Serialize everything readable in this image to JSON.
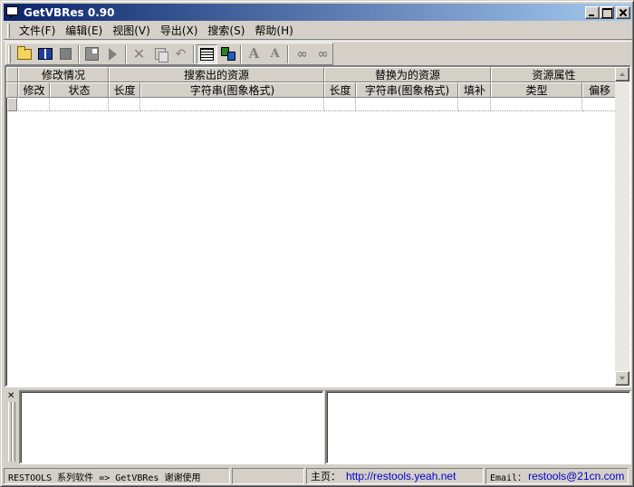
{
  "window": {
    "title": "GetVBRes 0.90"
  },
  "menu": {
    "items": [
      {
        "label": "文件(F)"
      },
      {
        "label": "编辑(E)"
      },
      {
        "label": "视图(V)"
      },
      {
        "label": "导出(X)"
      },
      {
        "label": "搜索(S)"
      },
      {
        "label": "帮助(H)"
      }
    ]
  },
  "toolbar": {
    "icons": [
      "open-folder-icon",
      "open-book-icon",
      "stop-icon",
      "export-icon",
      "play-icon",
      "cut-icon",
      "copy-icon",
      "undo-icon",
      "grid-view-icon",
      "network-icon",
      "font-icon",
      "font-small-icon",
      "binoculars-icon",
      "find-next-icon"
    ]
  },
  "list": {
    "group_headers": [
      {
        "label": "修改情况"
      },
      {
        "label": "搜索出的资源"
      },
      {
        "label": "替换为的资源"
      },
      {
        "label": "资源属性"
      }
    ],
    "columns": [
      {
        "label": "修改"
      },
      {
        "label": "状态"
      },
      {
        "label": "长度"
      },
      {
        "label": "字符串(图象格式)"
      },
      {
        "label": "长度"
      },
      {
        "label": "字符串(图象格式)"
      },
      {
        "label": "填补"
      },
      {
        "label": "类型"
      },
      {
        "label": "偏移"
      }
    ]
  },
  "statusbar": {
    "product": "RESTOOLS 系列软件 => GetVBRes  谢谢使用",
    "homepage_label": "主页：",
    "homepage_url": "http://restools.yeah.net",
    "email_label": "Email：",
    "email": "restools@21cn.com"
  }
}
